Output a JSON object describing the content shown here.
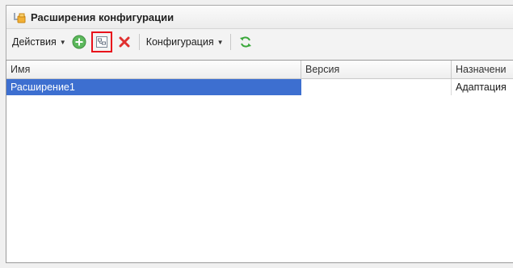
{
  "window": {
    "title": "Расширения конфигурации"
  },
  "toolbar": {
    "actions_label": "Действия",
    "configuration_label": "Конфигурация"
  },
  "table": {
    "columns": [
      "Имя",
      "Версия",
      "Назначени"
    ],
    "rows": [
      {
        "name": "Расширение1",
        "version": "",
        "purpose": "Адаптация"
      }
    ]
  },
  "colors": {
    "selection": "#3d6fd0",
    "highlight_frame": "#e8121b",
    "add_icon": "#5cb85c",
    "delete_icon": "#e0302f",
    "refresh_icon": "#3aa83a"
  }
}
